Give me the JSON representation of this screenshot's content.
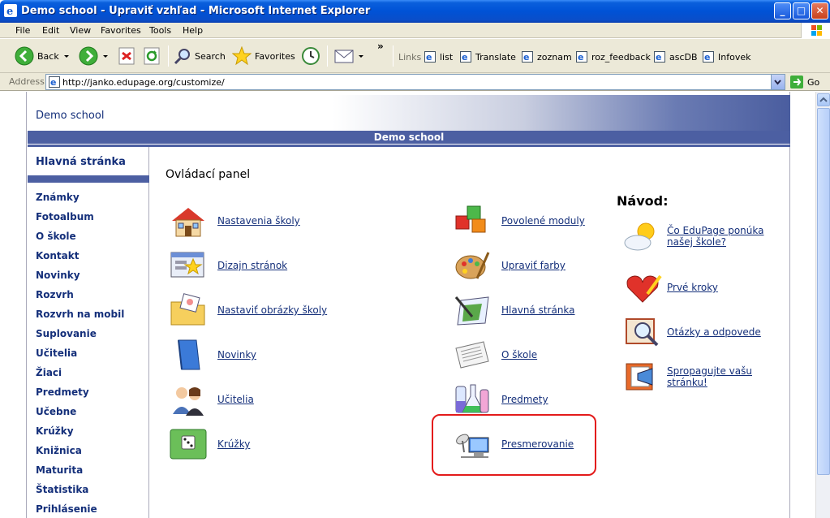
{
  "window": {
    "title": "Demo school - Upraviť vzhľad - Microsoft Internet Explorer",
    "controls": {
      "minimize": "_",
      "maximize": "□",
      "close": "✕"
    }
  },
  "menu": [
    "File",
    "Edit",
    "View",
    "Favorites",
    "Tools",
    "Help"
  ],
  "toolbar": {
    "back": "Back",
    "search": "Search",
    "favorites": "Favorites",
    "overflow": "»",
    "links_label": "Links",
    "links": [
      "list",
      "Translate",
      "zoznam",
      "roz_feedback",
      "ascDB",
      "Infovek"
    ]
  },
  "address": {
    "label": "Address",
    "url": "http://janko.edupage.org/customize/",
    "go": "Go"
  },
  "site": {
    "header_title": "Demo school",
    "bar_title": "Demo school",
    "home": "Hlavná stránka",
    "nav": [
      "Známky",
      "Fotoalbum",
      "O škole",
      "Kontakt",
      "Novinky",
      "Rozvrh",
      "Rozvrh na mobil",
      "Suplovanie",
      "Učitelia",
      "Žiaci",
      "Predmety",
      "Učebne",
      "Krúžky",
      "Knižnica",
      "Maturita",
      "Štatistika",
      "Prihlásenie"
    ]
  },
  "panel": {
    "title": "Ovládací panel",
    "left": [
      {
        "label": "Nastavenia školy",
        "icon": "house-icon"
      },
      {
        "label": "Dizajn stránok",
        "icon": "design-window-icon"
      },
      {
        "label": "Nastaviť obrázky školy",
        "icon": "image-folder-icon"
      },
      {
        "label": "Novinky",
        "icon": "book-icon"
      },
      {
        "label": "Učitelia",
        "icon": "people-icon"
      },
      {
        "label": "Krúžky",
        "icon": "dice-board-icon"
      }
    ],
    "right": [
      {
        "label": "Povolené moduly",
        "icon": "cubes-icon"
      },
      {
        "label": "Upraviť farby",
        "icon": "palette-icon"
      },
      {
        "label": "Hlavná stránka",
        "icon": "pen-page-icon"
      },
      {
        "label": "O škole",
        "icon": "newspaper-icon"
      },
      {
        "label": "Predmety",
        "icon": "flask-icon"
      },
      {
        "label": "Presmerovanie",
        "icon": "satellite-monitor-icon"
      }
    ]
  },
  "help": {
    "title": "Návod:",
    "items": [
      {
        "label": "Čo EduPage ponúka našej škole?",
        "icon": "sun-cloud-icon"
      },
      {
        "label": "Prvé kroky",
        "icon": "heart-pencil-icon"
      },
      {
        "label": "Otázky a odpovede",
        "icon": "magnifier-book-icon"
      },
      {
        "label": "Spropagujte vašu stránku!",
        "icon": "megaphone-page-icon"
      }
    ]
  },
  "colors": {
    "link": "#142f7a",
    "accent_bar": "#4c5fa2",
    "highlight": "#e31b1b"
  }
}
